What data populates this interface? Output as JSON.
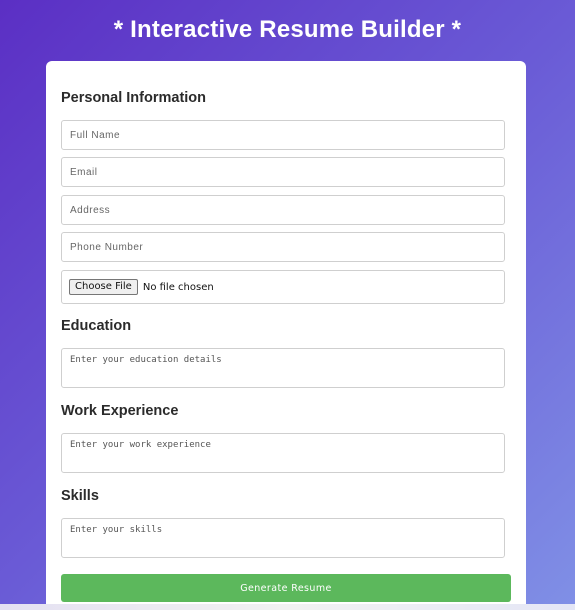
{
  "header": {
    "title": "* Interactive Resume Builder *"
  },
  "colors": {
    "accent": "#5cb85c",
    "background_start": "#5b2fc4",
    "background_end": "#8090e6"
  },
  "personal": {
    "heading": "Personal Information",
    "full_name_placeholder": "Full Name",
    "email_placeholder": "Email",
    "address_placeholder": "Address",
    "phone_placeholder": "Phone Number",
    "file_button_label": "Choose File",
    "file_status": "No file chosen"
  },
  "education": {
    "heading": "Education",
    "placeholder": "Enter your education details"
  },
  "work": {
    "heading": "Work Experience",
    "placeholder": "Enter your work experience"
  },
  "skills": {
    "heading": "Skills",
    "placeholder": "Enter your skills"
  },
  "actions": {
    "generate_label": "Generate Resume"
  }
}
